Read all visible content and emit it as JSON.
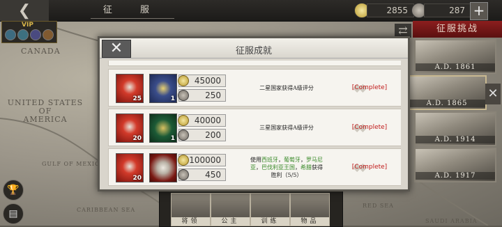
{
  "topbar": {
    "back_icon": "back-arrow-icon",
    "title": "征 服",
    "gold": "2855",
    "silver": "287",
    "plus": "+"
  },
  "vip": {
    "label": "VIP"
  },
  "map_labels": {
    "canada": "CANADA",
    "usa": "UNITED STATES\nOF\nAMERICA",
    "gulf": "GULF OF MEXICO",
    "caribbean": "CARIBBEAN SEA",
    "red_sea": "RED SEA",
    "saudi": "SAUDI ARABIA"
  },
  "challenge": {
    "tab_label": "征服挑战",
    "eras": [
      "A.D. 1861",
      "A.D. 1865",
      "A.D. 1914",
      "A.D. 1917"
    ]
  },
  "bottom_tabs": [
    "将领",
    "公主",
    "训练",
    "物品"
  ],
  "modal": {
    "title": "征服成就",
    "rows": [
      {
        "rewards": [
          {
            "kind": "red",
            "count": "25"
          },
          {
            "kind": "blue",
            "count": "1"
          }
        ],
        "gold": "45000",
        "silver": "250",
        "desc_parts": [
          {
            "t": "二星国家获得A级评分",
            "g": false
          }
        ],
        "status": "[Complete]"
      },
      {
        "rewards": [
          {
            "kind": "red",
            "count": "20"
          },
          {
            "kind": "green",
            "count": "1"
          }
        ],
        "gold": "40000",
        "silver": "200",
        "desc_parts": [
          {
            "t": "三星国家获得A级评分",
            "g": false
          }
        ],
        "status": "[Complete]"
      },
      {
        "rewards": [
          {
            "kind": "red",
            "count": "20"
          },
          {
            "kind": "maroon",
            "count": ""
          }
        ],
        "gold": "100000",
        "silver": "450",
        "desc_parts": [
          {
            "t": "使用",
            "g": false
          },
          {
            "t": "西班牙",
            "g": true
          },
          {
            "t": "，",
            "g": false
          },
          {
            "t": "葡萄牙",
            "g": true
          },
          {
            "t": "，",
            "g": false
          },
          {
            "t": "罗马尼亚",
            "g": true
          },
          {
            "t": "，",
            "g": false
          },
          {
            "t": "巴伐利亚王国",
            "g": true
          },
          {
            "t": "，",
            "g": false
          },
          {
            "t": "希腊",
            "g": true
          },
          {
            "t": "获得胜利（5/5）",
            "g": false
          }
        ],
        "status": "[Complete]"
      }
    ]
  }
}
